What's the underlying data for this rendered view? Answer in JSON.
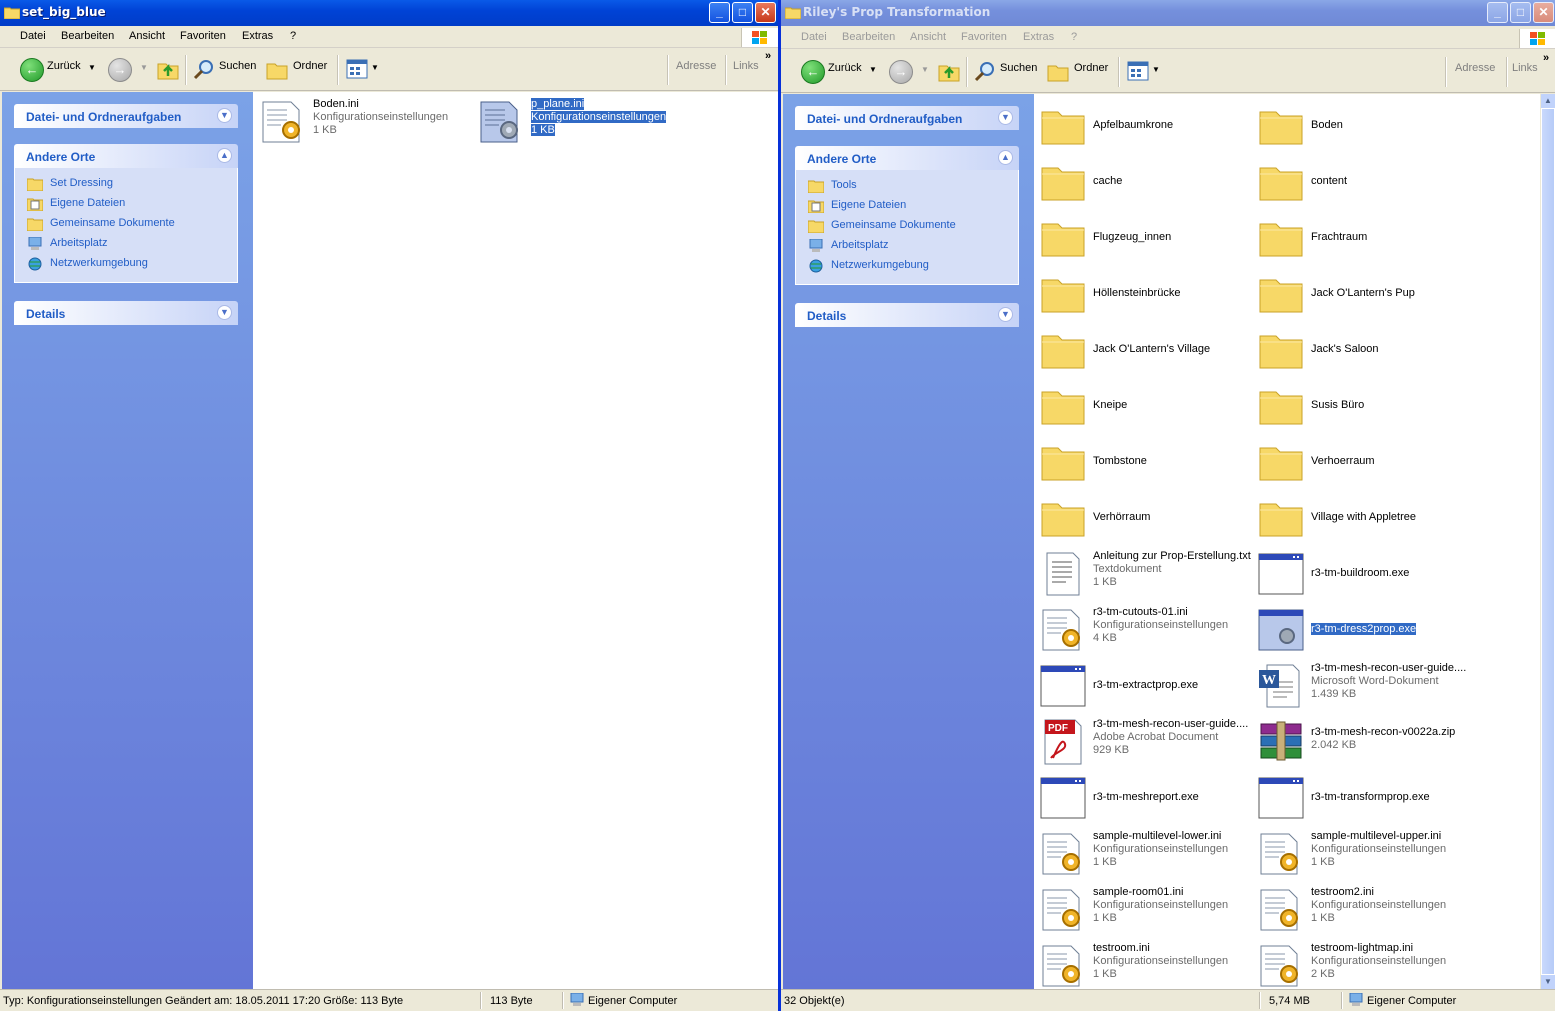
{
  "left": {
    "title": "set_big_blue",
    "menu": [
      "Datei",
      "Bearbeiten",
      "Ansicht",
      "Favoriten",
      "Extras",
      "?"
    ],
    "toolbar": {
      "back": "Zurück",
      "search": "Suchen",
      "folders": "Ordner",
      "address": "Adresse",
      "links": "Links"
    },
    "tasks_title": "Datei- und Ordneraufgaben",
    "places_title": "Andere Orte",
    "places": [
      "Set Dressing",
      "Eigene Dateien",
      "Gemeinsame Dokumente",
      "Arbeitsplatz",
      "Netzwerkumgebung"
    ],
    "details_title": "Details",
    "files": [
      {
        "name": "Boden.ini",
        "type": "Konfigurationseinstellungen",
        "size": "1 KB"
      },
      {
        "name": "p_plane.ini",
        "type": "Konfigurationseinstellungen",
        "size": "1 KB"
      }
    ],
    "status": {
      "info": "Typ: Konfigurationseinstellungen Geändert am: 18.05.2011 17:20 Größe: 113 Byte",
      "size": "113 Byte",
      "zone": "Eigener Computer"
    }
  },
  "right": {
    "title": "Riley's Prop Transformation",
    "menu": [
      "Datei",
      "Bearbeiten",
      "Ansicht",
      "Favoriten",
      "Extras",
      "?"
    ],
    "toolbar": {
      "back": "Zurück",
      "search": "Suchen",
      "folders": "Ordner",
      "address": "Adresse",
      "links": "Links"
    },
    "tasks_title": "Datei- und Ordneraufgaben",
    "places_title": "Andere Orte",
    "places": [
      "Tools",
      "Eigene Dateien",
      "Gemeinsame Dokumente",
      "Arbeitsplatz",
      "Netzwerkumgebung"
    ],
    "details_title": "Details",
    "folders": [
      "Apfelbaumkrone",
      "Boden",
      "cache",
      "content",
      "Flugzeug_innen",
      "Frachtraum",
      "Höllensteinbrücke",
      "Jack O'Lantern's Pup",
      "Jack O'Lantern's Village",
      "Jack's Saloon",
      "Kneipe",
      "Susis Büro",
      "Tombstone",
      "Verhoerraum",
      "Verhörraum",
      "Village with Appletree"
    ],
    "files": [
      {
        "name": "Anleitung zur Prop-Erstellung.txt",
        "type": "Textdokument",
        "size": "1 KB"
      },
      {
        "name": "r3-tm-buildroom.exe"
      },
      {
        "name": "r3-tm-cutouts-01.ini",
        "type": "Konfigurationseinstellungen",
        "size": "4 KB"
      },
      {
        "name": "r3-tm-dress2prop.exe"
      },
      {
        "name": "r3-tm-extractprop.exe"
      },
      {
        "name": "r3-tm-mesh-recon-user-guide....",
        "type": "Microsoft Word-Dokument",
        "size": "1.439 KB"
      },
      {
        "name": "r3-tm-mesh-recon-user-guide....",
        "type": "Adobe Acrobat Document",
        "size": "929 KB"
      },
      {
        "name": "r3-tm-mesh-recon-v0022a.zip",
        "type": "",
        "size": "2.042 KB"
      },
      {
        "name": "r3-tm-meshreport.exe"
      },
      {
        "name": "r3-tm-transformprop.exe"
      },
      {
        "name": "sample-multilevel-lower.ini",
        "type": "Konfigurationseinstellungen",
        "size": "1 KB"
      },
      {
        "name": "sample-multilevel-upper.ini",
        "type": "Konfigurationseinstellungen",
        "size": "1 KB"
      },
      {
        "name": "sample-room01.ini",
        "type": "Konfigurationseinstellungen",
        "size": "1 KB"
      },
      {
        "name": "testroom2.ini",
        "type": "Konfigurationseinstellungen",
        "size": "1 KB"
      },
      {
        "name": "testroom.ini",
        "type": "Konfigurationseinstellungen",
        "size": "1 KB"
      },
      {
        "name": "testroom-lightmap.ini",
        "type": "Konfigurationseinstellungen",
        "size": "2 KB"
      }
    ],
    "status": {
      "count": "32 Objekt(e)",
      "size": "5,74 MB",
      "zone": "Eigener Computer"
    }
  }
}
